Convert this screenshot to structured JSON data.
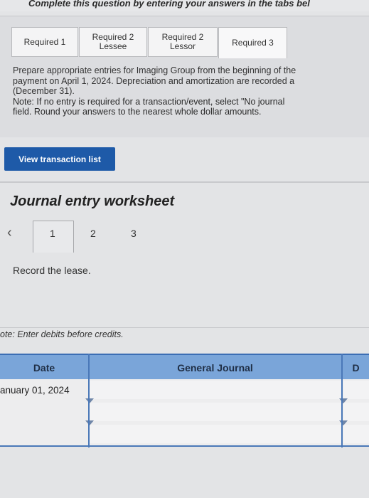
{
  "header": {
    "instruction": "Complete this question by entering your answers in the tabs bel"
  },
  "tabs": [
    {
      "label": "Required 1",
      "active": false
    },
    {
      "label": "Required 2\nLessee",
      "active": false
    },
    {
      "label": "Required 2\nLessor",
      "active": false
    },
    {
      "label": "Required 3",
      "active": true
    }
  ],
  "instructions": {
    "line1": "Prepare appropriate entries for Imaging Group from the beginning of the",
    "line2": "payment on April 1, 2024. Depreciation and amortization are recorded a",
    "line3": "(December 31).",
    "note1": "Note: If no entry is required for a transaction/event, select \"No journal",
    "note2": "field. Round your answers to the nearest whole dollar amounts."
  },
  "view_button": {
    "label": "View transaction list"
  },
  "worksheet": {
    "title": "Journal entry worksheet",
    "prev_icon": "chevron-left-icon",
    "pages": [
      "1",
      "2",
      "3"
    ],
    "current_page": "1",
    "transaction": "Record the lease.",
    "note": "ote: Enter debits before credits."
  },
  "journal": {
    "headers": {
      "date": "Date",
      "general_journal": "General Journal",
      "debit": "D"
    },
    "rows": [
      {
        "date": "anuary 01, 2024",
        "account": ""
      },
      {
        "date": "",
        "account": ""
      },
      {
        "date": "",
        "account": ""
      }
    ]
  },
  "colors": {
    "primary_button": "#1e5aa8",
    "table_header": "#7aa5d9",
    "table_border": "#4a78b8"
  }
}
